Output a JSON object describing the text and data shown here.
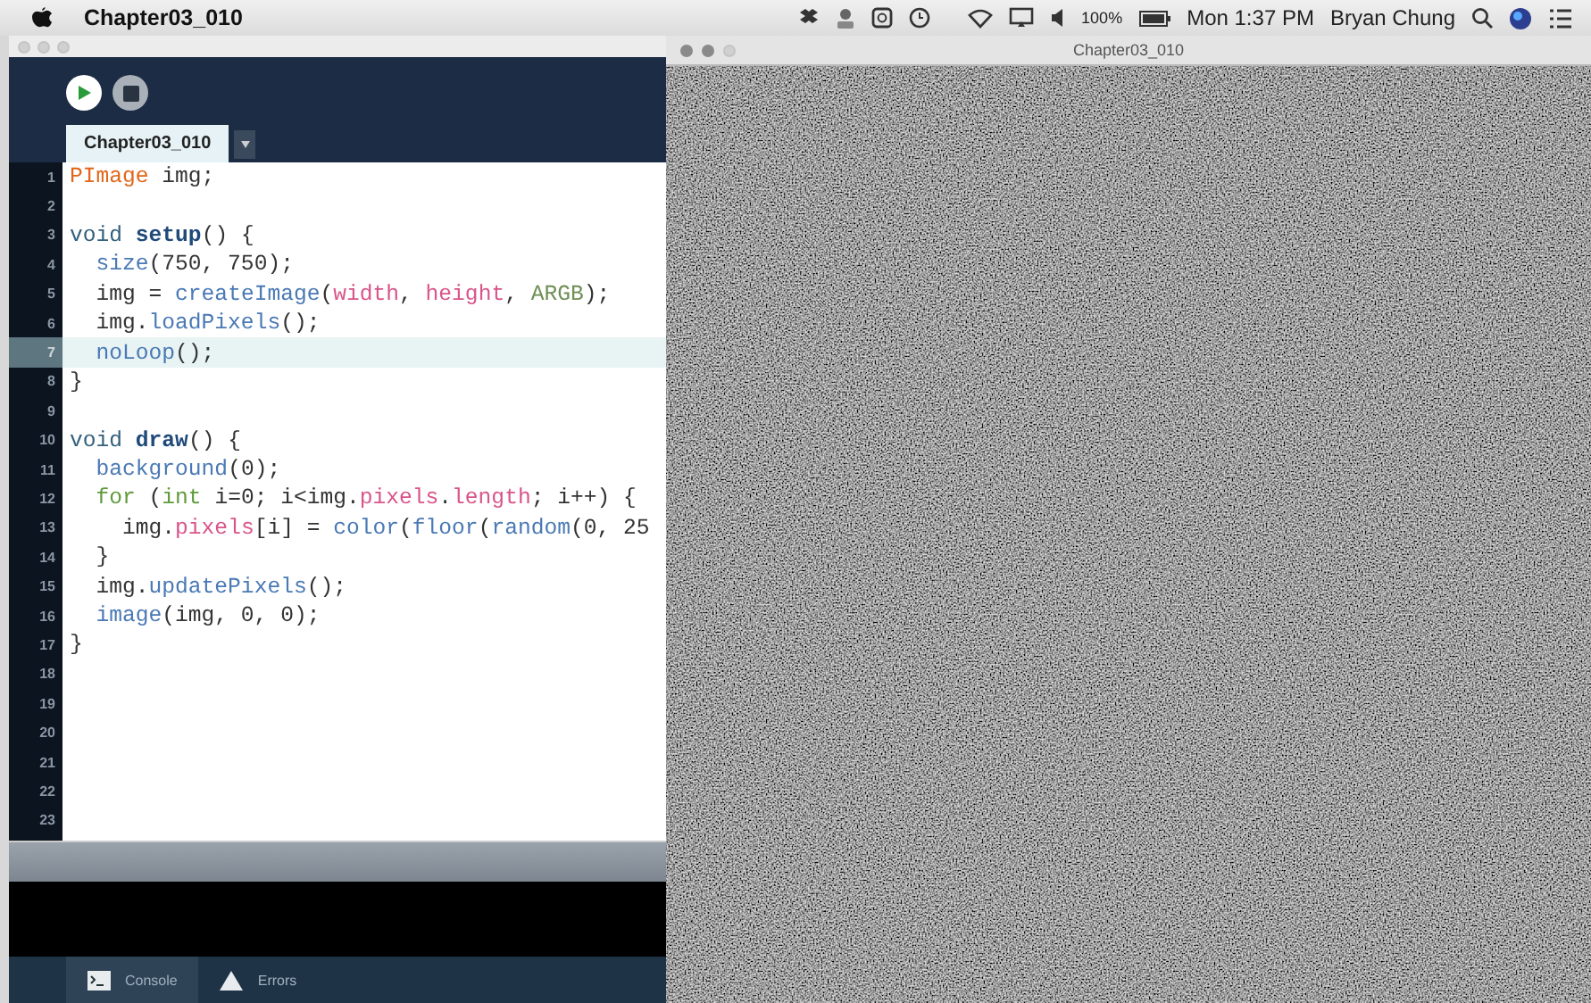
{
  "menu_bar": {
    "app_name": "Chapter03_010",
    "battery": "100%",
    "clock": "Mon 1:37 PM",
    "user": "Bryan Chung"
  },
  "editor_window": {
    "toolbar": {
      "buttons": [
        {
          "kind": "run"
        },
        {
          "kind": "stop"
        }
      ]
    },
    "tabs": [
      {
        "label": "Chapter03_010",
        "selected": true
      }
    ],
    "lines": [
      {
        "number": "1",
        "highlighted": false,
        "tokens": [
          {
            "kind": "type",
            "text": "PImage"
          },
          {
            "kind": "plain",
            "text": " img;"
          }
        ]
      },
      {
        "number": "2",
        "highlighted": false
      },
      {
        "number": "3",
        "highlighted": false,
        "tokens": [
          {
            "kind": "keyword",
            "text": "void "
          },
          {
            "kind": "define",
            "text": "setup"
          },
          {
            "kind": "plain",
            "text": "() {"
          }
        ]
      },
      {
        "number": "4",
        "highlighted": false,
        "tokens": [
          {
            "kind": "function",
            "text": "  size"
          },
          {
            "kind": "plain",
            "text": "(750, 750);"
          }
        ]
      },
      {
        "number": "5",
        "highlighted": false,
        "tokens": [
          {
            "kind": "plain",
            "text": "  img = "
          },
          {
            "kind": "function",
            "text": "createImage"
          },
          {
            "kind": "plain",
            "text": "("
          },
          {
            "kind": "variable",
            "text": "width"
          },
          {
            "kind": "plain",
            "text": ", "
          },
          {
            "kind": "variable",
            "text": "height"
          },
          {
            "kind": "plain",
            "text": ", "
          },
          {
            "kind": "constant",
            "text": "ARGB"
          },
          {
            "kind": "plain",
            "text": ");"
          }
        ]
      },
      {
        "number": "6",
        "highlighted": false,
        "tokens": [
          {
            "kind": "plain",
            "text": "  img."
          },
          {
            "kind": "function",
            "text": "loadPixels"
          },
          {
            "kind": "plain",
            "text": "();"
          }
        ]
      },
      {
        "number": "7",
        "highlighted": true,
        "tokens": [
          {
            "kind": "function",
            "text": "  noLoop"
          },
          {
            "kind": "plain",
            "text": "();"
          }
        ]
      },
      {
        "number": "8",
        "highlighted": false,
        "tokens": [
          {
            "kind": "plain",
            "text": "}"
          }
        ]
      },
      {
        "number": "9",
        "highlighted": false
      },
      {
        "number": "10",
        "highlighted": false,
        "tokens": [
          {
            "kind": "keyword",
            "text": "void "
          },
          {
            "kind": "define",
            "text": "draw"
          },
          {
            "kind": "plain",
            "text": "() {"
          }
        ]
      },
      {
        "number": "11",
        "highlighted": false,
        "tokens": [
          {
            "kind": "function",
            "text": "  background"
          },
          {
            "kind": "plain",
            "text": "(0);"
          }
        ]
      },
      {
        "number": "12",
        "highlighted": false,
        "tokens": [
          {
            "kind": "control",
            "text": "  for"
          },
          {
            "kind": "plain",
            "text": " ("
          },
          {
            "kind": "control",
            "text": "int"
          },
          {
            "kind": "plain",
            "text": " i=0; i<img."
          },
          {
            "kind": "variable",
            "text": "pixels"
          },
          {
            "kind": "plain",
            "text": "."
          },
          {
            "kind": "variable",
            "text": "length"
          },
          {
            "kind": "plain",
            "text": "; i++) {"
          }
        ]
      },
      {
        "number": "13",
        "highlighted": false,
        "tokens": [
          {
            "kind": "plain",
            "text": "    img."
          },
          {
            "kind": "variable",
            "text": "pixels"
          },
          {
            "kind": "plain",
            "text": "[i] = "
          },
          {
            "kind": "function",
            "text": "color"
          },
          {
            "kind": "plain",
            "text": "("
          },
          {
            "kind": "function",
            "text": "floor"
          },
          {
            "kind": "plain",
            "text": "("
          },
          {
            "kind": "function",
            "text": "random"
          },
          {
            "kind": "plain",
            "text": "(0, 25"
          }
        ]
      },
      {
        "number": "14",
        "highlighted": false,
        "tokens": [
          {
            "kind": "plain",
            "text": "  }"
          }
        ]
      },
      {
        "number": "15",
        "highlighted": false,
        "tokens": [
          {
            "kind": "plain",
            "text": "  img."
          },
          {
            "kind": "function",
            "text": "updatePixels"
          },
          {
            "kind": "plain",
            "text": "();"
          }
        ]
      },
      {
        "number": "16",
        "highlighted": false,
        "tokens": [
          {
            "kind": "function",
            "text": "  image"
          },
          {
            "kind": "plain",
            "text": "(img, 0, 0);"
          }
        ]
      },
      {
        "number": "17",
        "highlighted": false,
        "tokens": [
          {
            "kind": "plain",
            "text": "}"
          }
        ]
      },
      {
        "number": "18",
        "highlighted": false
      },
      {
        "number": "19",
        "highlighted": false
      },
      {
        "number": "20",
        "highlighted": false
      },
      {
        "number": "21",
        "highlighted": false
      },
      {
        "number": "22",
        "highlighted": false
      },
      {
        "number": "23",
        "highlighted": false
      }
    ],
    "console_tabs": [
      {
        "label": "Console",
        "kind": "console",
        "selected": true
      },
      {
        "label": "Errors",
        "kind": "errors",
        "selected": false
      }
    ]
  },
  "sketch_window": {
    "title": "Chapter03_010"
  }
}
